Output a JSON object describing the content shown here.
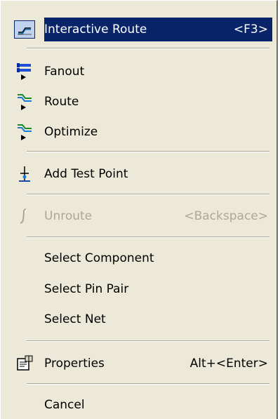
{
  "menu": {
    "items": [
      {
        "label": "Interactive Route",
        "shortcut": "<F3>",
        "icon": "interactive-route-icon"
      },
      {
        "label": "Fanout",
        "shortcut": "",
        "icon": "fanout-icon"
      },
      {
        "label": "Route",
        "shortcut": "",
        "icon": "route-icon"
      },
      {
        "label": "Optimize",
        "shortcut": "",
        "icon": "optimize-icon"
      },
      {
        "label": "Add Test Point",
        "shortcut": "",
        "icon": "test-point-icon"
      },
      {
        "label": "Unroute",
        "shortcut": "<Backspace>",
        "icon": "unroute-icon"
      },
      {
        "label": "Select Component",
        "shortcut": ""
      },
      {
        "label": "Select Pin Pair",
        "shortcut": ""
      },
      {
        "label": "Select Net",
        "shortcut": ""
      },
      {
        "label": "Properties",
        "shortcut": "Alt+<Enter>",
        "icon": "properties-icon"
      },
      {
        "label": "Cancel",
        "shortcut": ""
      }
    ]
  },
  "colors": {
    "menu_background": "#ece9d8",
    "highlight": "#0a246a",
    "disabled_text": "#aca899"
  }
}
